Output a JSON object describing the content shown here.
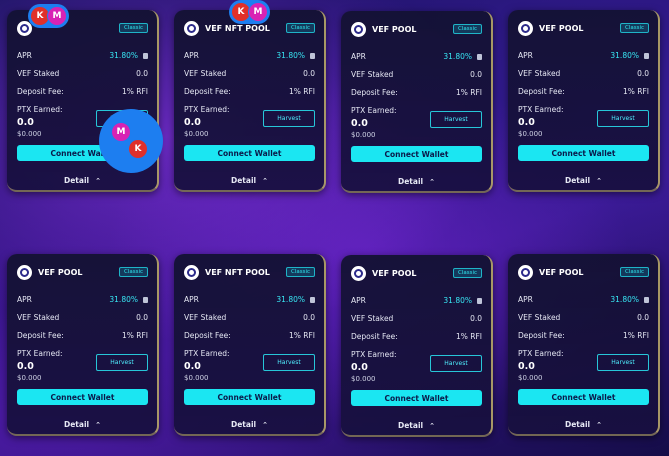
{
  "pools": [
    {
      "title": "",
      "badge": "Classic",
      "apr_label": "APR",
      "apr": "31.80%",
      "staked_label": "VEF Staked",
      "staked": "0.0",
      "fee_label": "Deposit Fee:",
      "fee": "1% RFI",
      "earn_label": "PTX Earned:",
      "earned": "0.0",
      "earned_usd": "$0.000",
      "harvest": "Harvest",
      "connect": "Connect Wallet",
      "detail": "Detail"
    },
    {
      "title": "VEF NFT POOL",
      "badge": "Classic",
      "apr_label": "APR",
      "apr": "31.80%",
      "staked_label": "VEF Staked",
      "staked": "0.0",
      "fee_label": "Deposit Fee:",
      "fee": "1% RFI",
      "earn_label": "PTX Earned:",
      "earned": "0.0",
      "earned_usd": "$0.000",
      "harvest": "Harvest",
      "connect": "Connect Wallet",
      "detail": "Detail"
    },
    {
      "title": "VEF POOL",
      "badge": "Classic",
      "apr_label": "APR",
      "apr": "31.80%",
      "staked_label": "VEF Staked",
      "staked": "0.0",
      "fee_label": "Deposit Fee:",
      "fee": "1% RFI",
      "earn_label": "PTX Earned:",
      "earned": "0.0",
      "earned_usd": "$0.000",
      "harvest": "Harvest",
      "connect": "Connect Wallet",
      "detail": "Detail"
    },
    {
      "title": "VEF POOL",
      "badge": "Classic",
      "apr_label": "APR",
      "apr": "31.80%",
      "staked_label": "VEF Staked",
      "staked": "0.0",
      "fee_label": "Deposit Fee:",
      "fee": "1% RFI",
      "earn_label": "PTX Earned:",
      "earned": "0.0",
      "earned_usd": "$0.000",
      "harvest": "Harvest",
      "connect": "Connect Wallet",
      "detail": "Detail"
    },
    {
      "title": "VEF POOL",
      "badge": "Classic",
      "apr_label": "APR",
      "apr": "31.80%",
      "staked_label": "VEF Staked",
      "staked": "0.0",
      "fee_label": "Deposit Fee:",
      "fee": "1% RFI",
      "earn_label": "PTX Earned:",
      "earned": "0.0",
      "earned_usd": "$0.000",
      "harvest": "Harvest",
      "connect": "Connect Wallet",
      "detail": "Detail"
    },
    {
      "title": "VEF NFT POOL",
      "badge": "Classic",
      "apr_label": "APR",
      "apr": "31.80%",
      "staked_label": "VEF Staked",
      "staked": "0.0",
      "fee_label": "Deposit Fee:",
      "fee": "1% RFI",
      "earn_label": "PTX Earned:",
      "earned": "0.0",
      "earned_usd": "$0.000",
      "harvest": "Harvest",
      "connect": "Connect Wallet",
      "detail": "Detail"
    },
    {
      "title": "VEF POOL",
      "badge": "Classic",
      "apr_label": "APR",
      "apr": "31.80%",
      "staked_label": "VEF Staked",
      "staked": "0.0",
      "fee_label": "Deposit Fee:",
      "fee": "1% RFI",
      "earn_label": "PTX Earned:",
      "earned": "0.0",
      "earned_usd": "$0.000",
      "harvest": "Harvest",
      "connect": "Connect Wallet",
      "detail": "Detail"
    },
    {
      "title": "VEF POOL",
      "badge": "Classic",
      "apr_label": "APR",
      "apr": "31.80%",
      "staked_label": "VEF Staked",
      "staked": "0.0",
      "fee_label": "Deposit Fee:",
      "fee": "1% RFI",
      "earn_label": "PTX Earned:",
      "earned": "0.0",
      "earned_usd": "$0.000",
      "harvest": "Harvest",
      "connect": "Connect Wallet",
      "detail": "Detail"
    }
  ],
  "avatars": {
    "k": "K",
    "m": "M",
    "colors": {
      "k": "#e0302a",
      "m": "#d823b4",
      "ring": "#1d7ef0"
    }
  },
  "theme": {
    "accent": "#1be6f2",
    "apr_color": "#38e8f5",
    "border_gold": "#e6d278"
  }
}
